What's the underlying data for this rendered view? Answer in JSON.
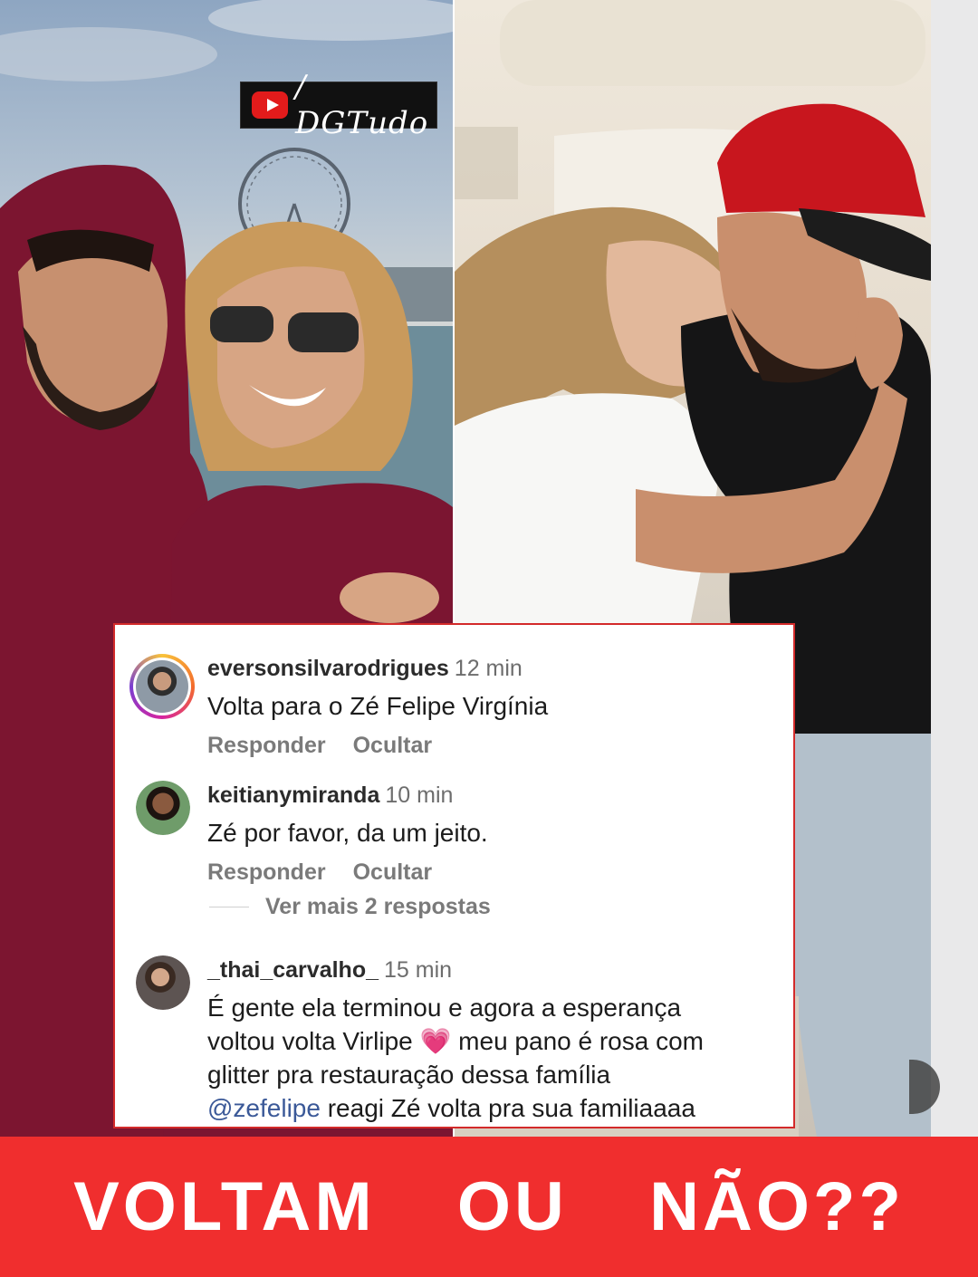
{
  "watermark": {
    "text": "/ DGTudo",
    "icon": "youtube-icon"
  },
  "comments": [
    {
      "username": "eversonsilvarodrigues",
      "time": "12 min",
      "text": "Volta para o Zé Felipe Virgínia",
      "reply_label": "Responder",
      "hide_label": "Ocultar"
    },
    {
      "username": "keitianymiranda",
      "time": "10 min",
      "text": "Zé por favor, da um jeito.",
      "reply_label": "Responder",
      "hide_label": "Ocultar"
    },
    {
      "username": "_thai_carvalho_",
      "time": "15 min",
      "text_line1": "É gente ela terminou e agora a esperança",
      "text_line2a": "voltou volta Virlipe",
      "emoji": "💗",
      "text_line2b": "meu pano é rosa com",
      "text_line3": "glitter pra restauração dessa família",
      "mention": "@zefelipe",
      "text_line4": "reagi Zé volta pra sua familiaaaa"
    }
  ],
  "more_replies": "Ver mais 2 respostas",
  "banner": {
    "text": "VOLTAM  OU  NÃO??"
  },
  "colors": {
    "banner": "#f02e2e",
    "card_border": "#d32a2a",
    "mention": "#3b5998"
  }
}
